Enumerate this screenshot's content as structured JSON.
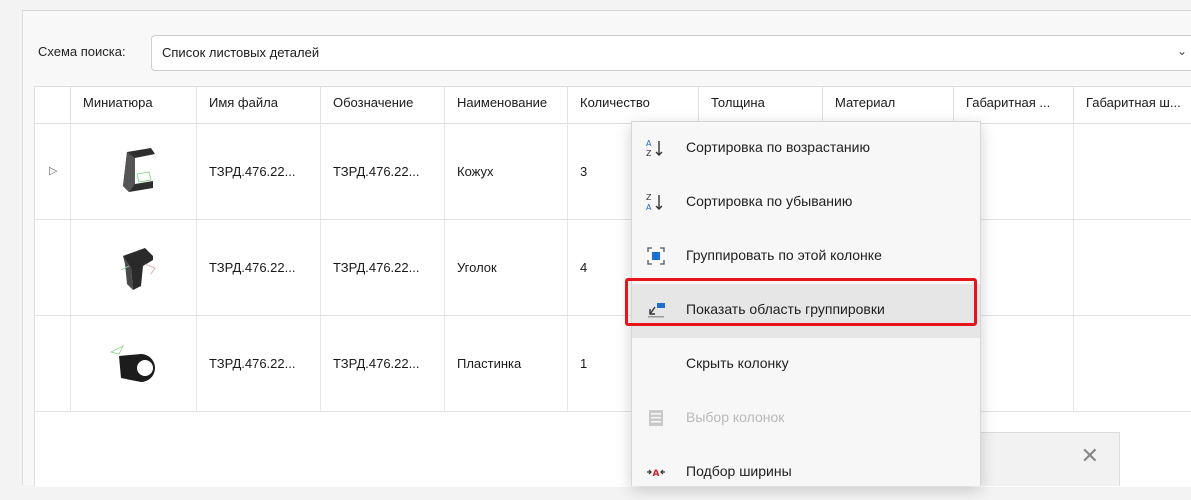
{
  "search": {
    "label": "Схема поиска:",
    "value": "Список листовых деталей"
  },
  "grid": {
    "columns": [
      "Миниатюра",
      "Имя файла",
      "Обозначение",
      "Наименование",
      "Количество",
      "Толщина",
      "Материал",
      "Габаритная ...",
      "Габаритная ш..."
    ],
    "rows": [
      {
        "file": "ТЗРД.476.22...",
        "designation": "ТЗРД.476.22...",
        "name": "Кожух",
        "qty": "3",
        "thumb": "cover-part-thumbnail"
      },
      {
        "file": "ТЗРД.476.22...",
        "designation": "ТЗРД.476.22...",
        "name": "Уголок",
        "qty": "4",
        "thumb": "angle-part-thumbnail"
      },
      {
        "file": "ТЗРД.476.22...",
        "designation": "ТЗРД.476.22...",
        "name": "Пластинка",
        "qty": "1",
        "thumb": "plate-part-thumbnail"
      }
    ]
  },
  "context_menu": {
    "items": [
      {
        "label": "Сортировка по возрастанию",
        "icon": "sort-ascending-icon"
      },
      {
        "label": "Сортировка по убыванию",
        "icon": "sort-descending-icon"
      },
      {
        "label": "Группировать по этой колонке",
        "icon": "group-by-column-icon"
      },
      {
        "label": "Показать область группировки",
        "icon": "show-group-area-icon"
      },
      {
        "label": "Скрыть колонку"
      },
      {
        "label": "Выбор колонок",
        "icon": "column-chooser-icon"
      },
      {
        "label": "Подбор ширины",
        "icon": "best-fit-icon"
      }
    ]
  },
  "colors": {
    "highlight_border": "#e8141c",
    "accent": "#1f6fd1"
  }
}
